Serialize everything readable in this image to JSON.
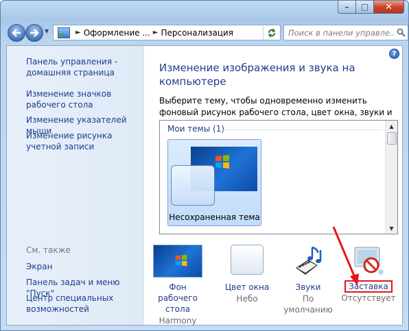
{
  "window": {
    "min_glyph": "–",
    "max_glyph": "□",
    "close_glyph": "✕"
  },
  "nav": {
    "breadcrumb": [
      "Оформление ...",
      "Персонализация"
    ],
    "search_placeholder": "Поиск в панели управле..."
  },
  "sidebar": {
    "links": [
      "Панель управления - домашняя страница",
      "Изменение значков рабочего стола",
      "Изменение указателей мыши",
      "Изменение рисунка учетной записи"
    ],
    "see_also_heading": "См. также",
    "see_also": [
      "Экран",
      "Панель задач и меню \"Пуск\"",
      "Центр специальных возможностей"
    ]
  },
  "main": {
    "title": "Изменение изображения и звука на компьютере",
    "description": "Выберите тему, чтобы одновременно изменить фоновый рисунок рабочего стола, цвет окна, звуки и заставку.",
    "group_label": "Мои темы (1)",
    "theme_name": "Несохраненная тема"
  },
  "settings": [
    {
      "label": "Фон рабочего стола",
      "value": "Harmony",
      "icon": "desktop-background-icon"
    },
    {
      "label": "Цвет окна",
      "value": "Небо",
      "icon": "window-color-icon"
    },
    {
      "label": "Звуки",
      "value": "По умолчанию",
      "icon": "sounds-icon"
    },
    {
      "label": "Заставка",
      "value": "Отсутствует",
      "icon": "screensaver-icon"
    }
  ],
  "colors": {
    "link": "#1e3d8a",
    "highlight": "#e4141c"
  }
}
